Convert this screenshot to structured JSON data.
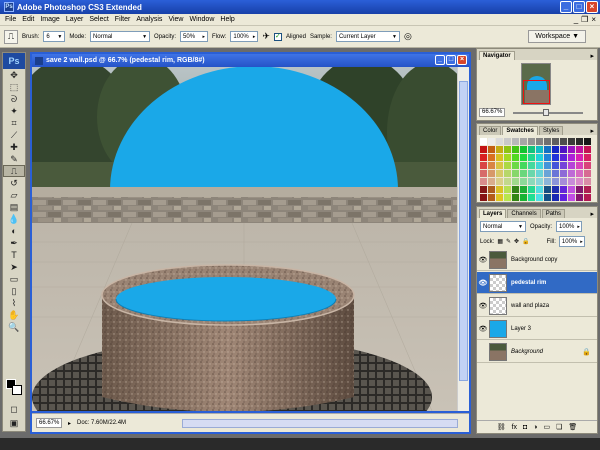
{
  "app": {
    "title": "Adobe Photoshop CS3 Extended",
    "logo": "Ps",
    "window_controls": [
      "_",
      "□",
      "×"
    ]
  },
  "menu": [
    "File",
    "Edit",
    "Image",
    "Layer",
    "Select",
    "Filter",
    "Analysis",
    "View",
    "Window",
    "Help"
  ],
  "options": {
    "brush_label": "Brush:",
    "brush_size": "6",
    "mode_label": "Mode:",
    "mode_value": "Normal",
    "opacity_label": "Opacity:",
    "opacity_value": "50%",
    "flow_label": "Flow:",
    "flow_value": "100%",
    "aligned_label": "Aligned",
    "sample_label": "Sample:",
    "sample_value": "Current Layer",
    "workspace_label": "Workspace"
  },
  "document": {
    "title": "save 2 wall.psd @ 66.7% (pedestal rim, RGB/8#)",
    "zoom": "66.67%",
    "doc_info": "Doc: 7.60M/22.4M"
  },
  "navigator": {
    "tabs": [
      "Navigator"
    ],
    "zoom": "66.67%"
  },
  "swatches": {
    "tabs": [
      "Color",
      "Swatches",
      "Styles"
    ],
    "active_tab": "Swatches"
  },
  "layers": {
    "tabs": [
      "Layers",
      "Channels",
      "Paths"
    ],
    "blend_mode": "Normal",
    "opacity_label": "Opacity:",
    "opacity_value": "100%",
    "lock_label": "Lock:",
    "fill_label": "Fill:",
    "fill_value": "100%",
    "items": [
      {
        "name": "Background copy",
        "visible": true,
        "active": false
      },
      {
        "name": "pedestal rim",
        "visible": true,
        "active": true
      },
      {
        "name": "wall and plaza",
        "visible": true,
        "active": false
      },
      {
        "name": "Layer 3",
        "visible": true,
        "active": false
      },
      {
        "name": "Background",
        "visible": false,
        "active": false,
        "locked": true
      }
    ],
    "bottom_icons": [
      "link-icon",
      "fx-icon",
      "mask-icon",
      "adjustment-icon",
      "folder-icon",
      "new-layer-icon",
      "trash-icon"
    ]
  },
  "colors": {
    "accent_blue": "#1aa8e8",
    "titlebar": "#2553c7",
    "selected_layer": "#316ac5"
  }
}
